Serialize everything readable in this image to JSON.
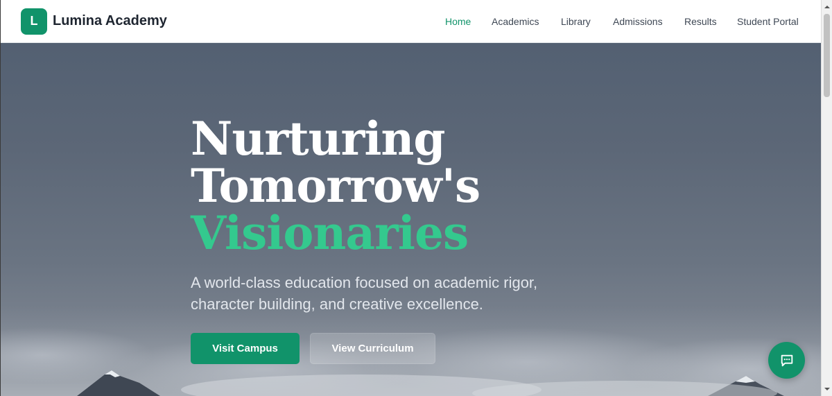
{
  "brand": {
    "logo_letter": "L",
    "name": "Lumina Academy"
  },
  "nav": {
    "items": [
      {
        "label": "Home",
        "active": true
      },
      {
        "label": "Academics",
        "active": false
      },
      {
        "label": "Library",
        "active": false
      },
      {
        "label": "Admissions",
        "active": false
      },
      {
        "label": "Results",
        "active": false
      },
      {
        "label": "Student Portal",
        "active": false
      }
    ]
  },
  "hero": {
    "headline_line1": "Nurturing",
    "headline_line2": "Tomorrow's",
    "headline_accent": "Visionaries",
    "subtext": "A world-class education focused on academic rigor, character building, and creative excellence.",
    "primary_cta": "Visit Campus",
    "secondary_cta": "View Curriculum"
  },
  "chat": {
    "icon": "chat-bubble-icon"
  },
  "colors": {
    "brand": "#11936a",
    "accent": "#34c98e",
    "header_bg": "#ffffff",
    "text_dark": "#1e2530"
  }
}
